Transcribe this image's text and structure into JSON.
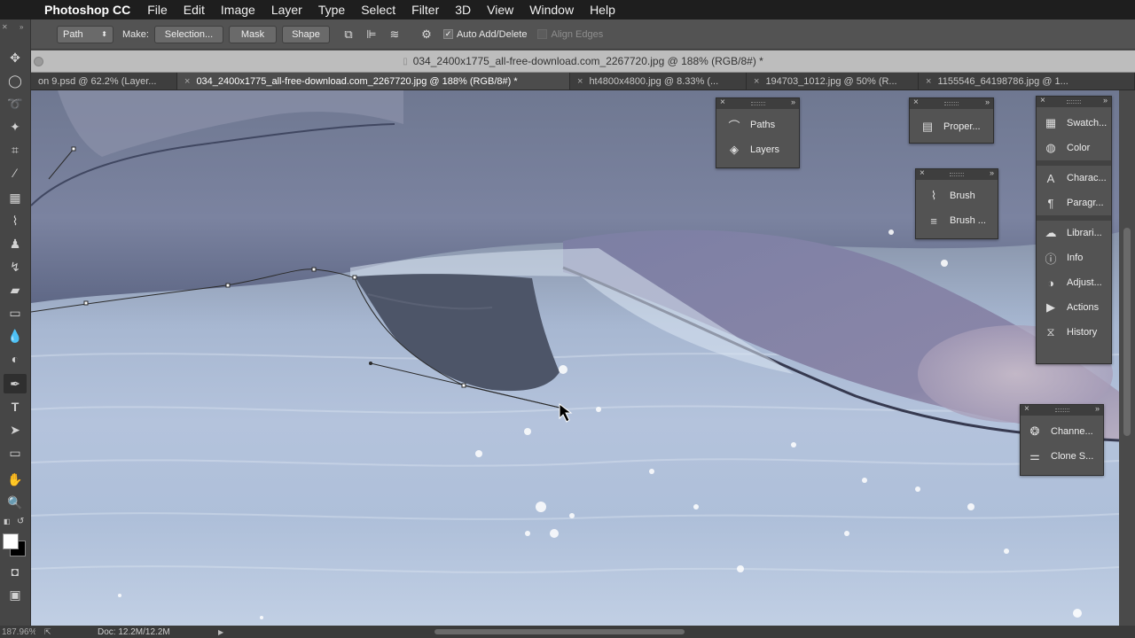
{
  "menubar": {
    "app_name": "Photoshop CC",
    "items": [
      "File",
      "Edit",
      "Image",
      "Layer",
      "Type",
      "Select",
      "Filter",
      "3D",
      "View",
      "Window",
      "Help"
    ]
  },
  "options": {
    "mode": "Path",
    "make_label": "Make:",
    "selection_btn": "Selection...",
    "mask_btn": "Mask",
    "shape_btn": "Shape",
    "auto_add_delete": "Auto Add/Delete",
    "align_edges": "Align Edges"
  },
  "document": {
    "title": "034_2400x1775_all-free-download.com_2267720.jpg @ 188% (RGB/8#) *"
  },
  "tabs": [
    {
      "label": "on 9.psd @ 62.2% (Layer..."
    },
    {
      "label": "034_2400x1775_all-free-download.com_2267720.jpg @ 188% (RGB/8#) *"
    },
    {
      "label": "ht4800x4800.jpg @ 8.33% (..."
    },
    {
      "label": "194703_1012.jpg @ 50% (R..."
    },
    {
      "label": "1155546_64198786.jpg @ 1..."
    }
  ],
  "panels": {
    "paths_layers": [
      "Paths",
      "Layers"
    ],
    "properties": [
      "Proper..."
    ],
    "brush": [
      "Brush",
      "Brush ..."
    ],
    "dock1": [
      "Swatch...",
      "Color"
    ],
    "dock2": [
      "Charac...",
      "Paragr..."
    ],
    "dock3": [
      "Librari...",
      "Info",
      "Adjust...",
      "Actions",
      "History"
    ],
    "channels": [
      "Channe...",
      "Clone S..."
    ]
  },
  "status": {
    "zoom": "187.96%",
    "doc": "Doc: 12.2M/12.2M"
  },
  "icons": {
    "apple": "apple-icon",
    "pen": "pen-tool-icon"
  }
}
